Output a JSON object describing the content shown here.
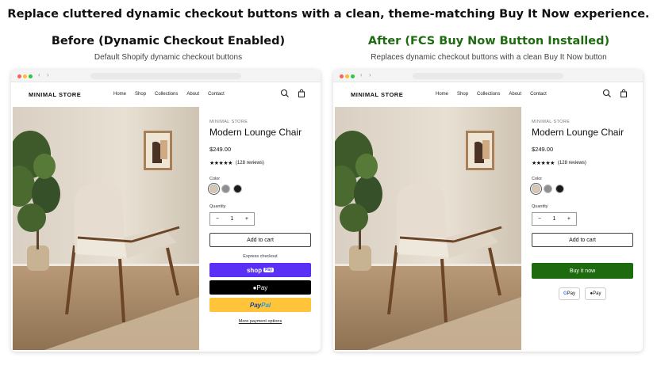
{
  "headline": "Replace cluttered dynamic checkout buttons with a clean, theme-matching Buy It Now experience.",
  "before": {
    "title": "Before (Dynamic Checkout Enabled)",
    "subtitle": "Default Shopify dynamic checkout buttons"
  },
  "after": {
    "title": "After (FCS Buy Now Button Installed)",
    "subtitle": "Replaces dynamic checkout buttons with a clean Buy It Now button"
  },
  "store": {
    "logo": "MINIMAL STORE",
    "menu": [
      "Home",
      "Shop",
      "Collections",
      "About",
      "Contact"
    ],
    "icons": [
      "search-icon",
      "cart-icon"
    ]
  },
  "product": {
    "brand": "MINIMAL STORE",
    "title": "Modern Lounge Chair",
    "price": "$249.00",
    "rating": 4.5,
    "reviews": "(128 reviews)",
    "color_label": "Color",
    "colors": [
      "#d8c8b0",
      "#8e8e8e",
      "#1a1a1a"
    ],
    "quantity_label": "Quantity",
    "quantity": "1",
    "minus": "−",
    "plus": "+",
    "add_to_cart": "Add to cart"
  },
  "before_checkout": {
    "express_label": "Express checkout",
    "shop_pay": "shop",
    "shop_pay_box": "Pay",
    "apple_pay": "Pay",
    "paypal_a": "Pay",
    "paypal_b": "Pal",
    "more_options": "More payment options"
  },
  "after_checkout": {
    "buy_now": "Buy it now",
    "gpay": "Pay",
    "apay": "Pay"
  },
  "colors": {
    "after_title": "#1f6b12",
    "buy_now": "#1d6b0e",
    "shop_pay": "#5a31f4",
    "paypal": "#ffc439"
  }
}
